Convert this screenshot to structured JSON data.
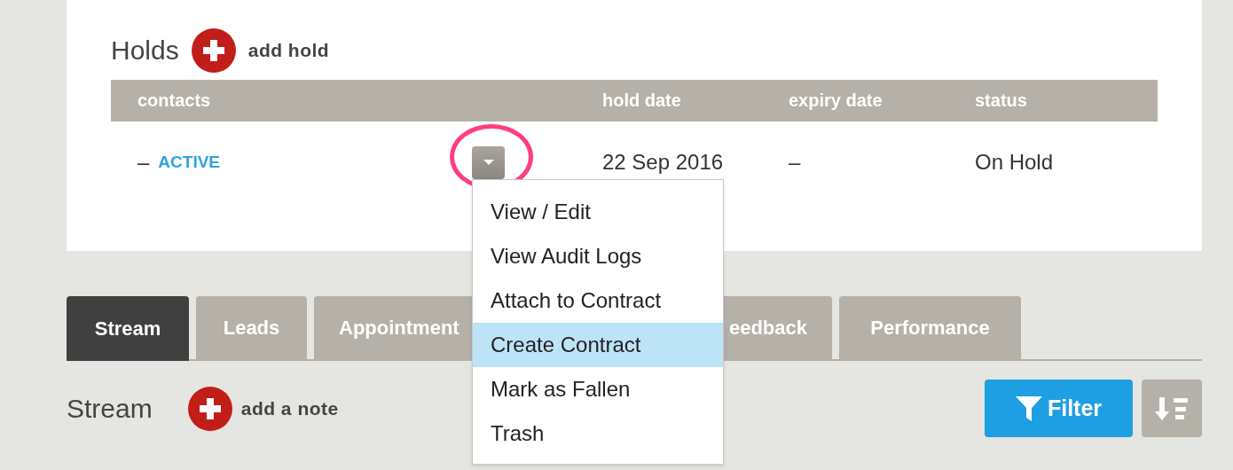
{
  "holds": {
    "title": "Holds",
    "add_label": "add hold",
    "columns": [
      "contacts",
      "hold date",
      "expiry date",
      "status"
    ],
    "rows": [
      {
        "contact_dash": "–",
        "contact_status": "ACTIVE",
        "hold_date": "22 Sep 2016",
        "expiry_date": "–",
        "status": "On Hold"
      }
    ]
  },
  "menu": {
    "items": [
      {
        "label": "View / Edit",
        "selected": false
      },
      {
        "label": "View Audit Logs",
        "selected": false
      },
      {
        "label": "Attach to Contract",
        "selected": false
      },
      {
        "label": "Create Contract",
        "selected": true
      },
      {
        "label": "Mark as Fallen",
        "selected": false
      },
      {
        "label": "Trash",
        "selected": false
      }
    ]
  },
  "tabs": [
    {
      "label": "Stream",
      "selected": true
    },
    {
      "label": "Leads",
      "selected": false
    },
    {
      "label": "Appointment",
      "selected": false
    },
    {
      "label": "eedback",
      "selected": false
    },
    {
      "label": "Performance",
      "selected": false
    }
  ],
  "stream": {
    "title": "Stream",
    "add_label": "add a note",
    "filter_label": "Filter"
  }
}
